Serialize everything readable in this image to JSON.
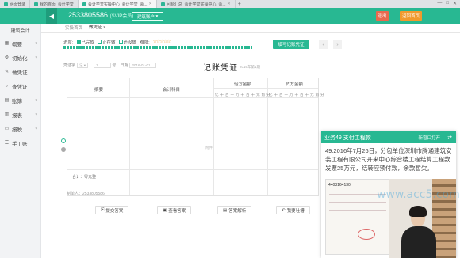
{
  "browser": {
    "tabs": [
      {
        "label": "网页登录"
      },
      {
        "label": "我的首页_会计学堂"
      },
      {
        "label": "会计学堂实操中心_会计学堂_会..."
      },
      {
        "label": "问题汇总_会计学堂实操中心_会..."
      }
    ]
  },
  "header": {
    "phone": "2533805586",
    "vip": "(SVIP会员)",
    "enterprise_button": "建筑账户",
    "exit_button": "退出",
    "home_button": "返回首页"
  },
  "sidebar": {
    "title": "建筑会计",
    "items": [
      {
        "label": "概要"
      },
      {
        "label": "初始化"
      },
      {
        "label": "做凭证"
      },
      {
        "label": "查凭证"
      },
      {
        "label": "账簿"
      },
      {
        "label": "报表"
      },
      {
        "label": "报税"
      },
      {
        "label": "手工账"
      }
    ]
  },
  "sub_tabs": [
    {
      "label": "实操首页"
    },
    {
      "label": "做凭证"
    }
  ],
  "progress": {
    "label": "进度:",
    "options": [
      "已完成",
      "正在做",
      "还没做"
    ],
    "difficulty_label": "难度:",
    "stars": "☆☆☆☆☆"
  },
  "fill_voucher_button": "填写记账凭证",
  "voucher": {
    "word_label": "凭证字",
    "word_value": "记",
    "no_label": "号",
    "no_value": "1",
    "date_label": "日期",
    "date_value": "2016-01-01",
    "title": "记账凭证",
    "period": "2016年第1期",
    "headers": {
      "summary": "摘要",
      "subject": "会计科目",
      "debit": "借方金额",
      "credit": "贷方金额"
    },
    "digit_units": "亿千百十万千百十元角分",
    "note": "附件",
    "total_label": "合计：零元整",
    "maker": "制单人：2533805586"
  },
  "actions": [
    {
      "label": "提交答案"
    },
    {
      "label": "查看答案"
    },
    {
      "label": "答案解析"
    },
    {
      "label": "我要吐槽"
    }
  ],
  "popup": {
    "title": "业务49 支付工程款",
    "new_window": "新窗口打开",
    "description": "49.2016年7月26日，分包单位深圳市腾通建筑安装工程有限公司开来中心综合楼工程结算工程款发票25万元，结转应预付款，余款暂欠。",
    "invoice_no": "4403164130",
    "watermark": "www.acc5.com"
  },
  "colors": {
    "accent": "#28b892",
    "exit": "#e9694e",
    "home": "#f19a2d"
  }
}
